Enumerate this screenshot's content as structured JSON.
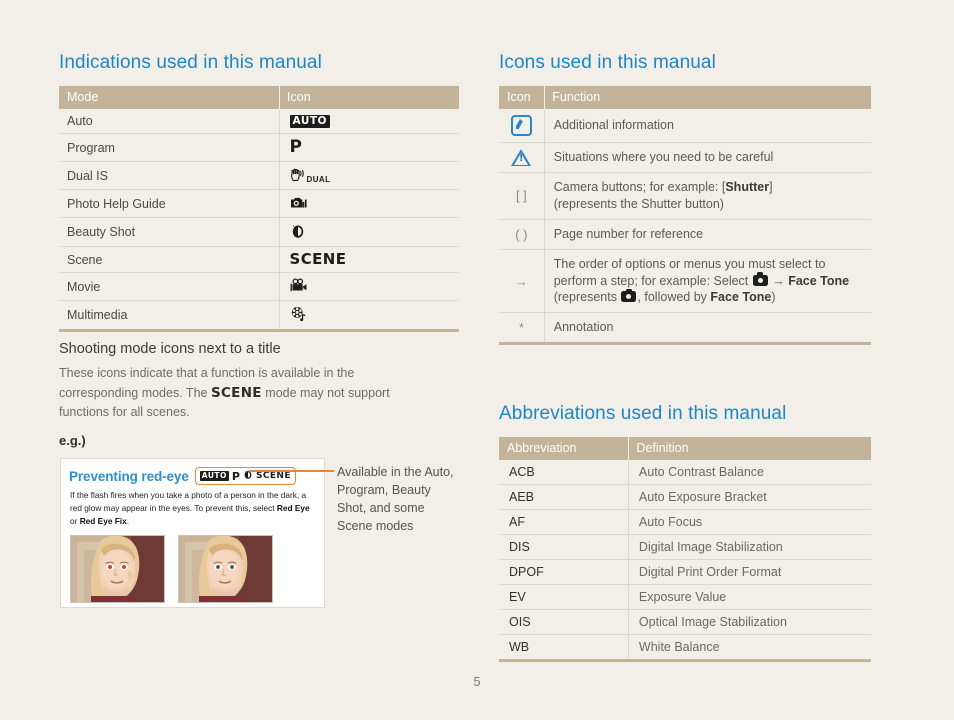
{
  "page": {
    "number": "5",
    "background_color": "#f2efe9",
    "heading_color": "#1b86c8",
    "table_header_color": "#c3b398",
    "accent_orange": "#e8873a"
  },
  "indications": {
    "title": "Indications used in this manual",
    "columns": [
      "Mode",
      "Icon"
    ],
    "rows": [
      {
        "mode": "Auto",
        "icon_name": "auto-mode-icon",
        "icon_text": "AUTO"
      },
      {
        "mode": "Program",
        "icon_name": "program-mode-icon",
        "icon_text": "P"
      },
      {
        "mode": "Dual IS",
        "icon_name": "dual-is-mode-icon",
        "icon_text": "DUAL"
      },
      {
        "mode": "Photo Help Guide",
        "icon_name": "photo-help-guide-icon",
        "icon_text": ""
      },
      {
        "mode": "Beauty Shot",
        "icon_name": "beauty-shot-icon",
        "icon_text": ""
      },
      {
        "mode": "Scene",
        "icon_name": "scene-mode-icon",
        "icon_text": "SCENE"
      },
      {
        "mode": "Movie",
        "icon_name": "movie-mode-icon",
        "icon_text": ""
      },
      {
        "mode": "Multimedia",
        "icon_name": "multimedia-mode-icon",
        "icon_text": ""
      }
    ]
  },
  "icons_table": {
    "title": "Icons used in this manual",
    "columns": [
      "Icon",
      "Function"
    ],
    "rows": [
      {
        "symbol": "",
        "symbol_name": "note-icon",
        "function": "Additional information"
      },
      {
        "symbol": "",
        "symbol_name": "caution-icon",
        "function": "Situations where you need to be careful"
      },
      {
        "symbol": "[ ]",
        "symbol_name": "square-brackets-icon",
        "function_line1_pre": "Camera buttons; for example: [",
        "function_line1_bold": "Shutter",
        "function_line1_post": "]",
        "function_line2": "(represents the Shutter button)"
      },
      {
        "symbol": "( )",
        "symbol_name": "parentheses-icon",
        "function": "Page number for reference"
      },
      {
        "symbol": "→",
        "symbol_name": "arrow-right-icon",
        "function_line1": "The order of options or menus you must select to",
        "function_line2_pre": "perform a step; for example: Select ",
        "function_line2_mid": " → ",
        "function_line2_bold": "Face Tone",
        "function_line3_pre": "(represents ",
        "function_line3_mid": ", followed by ",
        "function_line3_bold": "Face Tone",
        "function_line3_post": ")"
      },
      {
        "symbol": "*",
        "symbol_name": "asterisk-icon",
        "function": "Annotation"
      }
    ]
  },
  "abbreviations": {
    "title": "Abbreviations used in this manual",
    "columns": [
      "Abbreviation",
      "Definition"
    ],
    "rows": [
      {
        "abbr": "ACB",
        "def": "Auto Contrast Balance"
      },
      {
        "abbr": "AEB",
        "def": "Auto Exposure Bracket"
      },
      {
        "abbr": "AF",
        "def": "Auto Focus"
      },
      {
        "abbr": "DIS",
        "def": "Digital Image Stabilization"
      },
      {
        "abbr": "DPOF",
        "def": "Digital Print Order Format"
      },
      {
        "abbr": "EV",
        "def": "Exposure Value"
      },
      {
        "abbr": "OIS",
        "def": "Optical Image Stabilization"
      },
      {
        "abbr": "WB",
        "def": "White Balance"
      }
    ]
  },
  "shooting_modes": {
    "heading": "Shooting mode icons next to a title",
    "body_part1": "These icons indicate that a function is available in the corresponding modes. The ",
    "body_scene": "SCENE",
    "body_part2": " mode may not support functions for all scenes.",
    "eg_label": "e.g.)"
  },
  "example": {
    "title": "Preventing red-eye",
    "badge_modes": [
      "AUTO",
      "P",
      "beauty-shot-icon",
      "SCENE"
    ],
    "body_pre": "If the flash fires when you take a photo of a person in the dark, a red glow may appear in the eyes. To prevent this, select ",
    "body_bold1": "Red Eye",
    "body_mid": " or ",
    "body_bold2": "Red Eye Fix",
    "body_post": ".",
    "photo_left_alt": "portrait-with-red-eye",
    "photo_right_alt": "portrait-corrected"
  },
  "annotation": {
    "text": "Available in the Auto, Program, Beauty Shot, and some Scene modes"
  }
}
